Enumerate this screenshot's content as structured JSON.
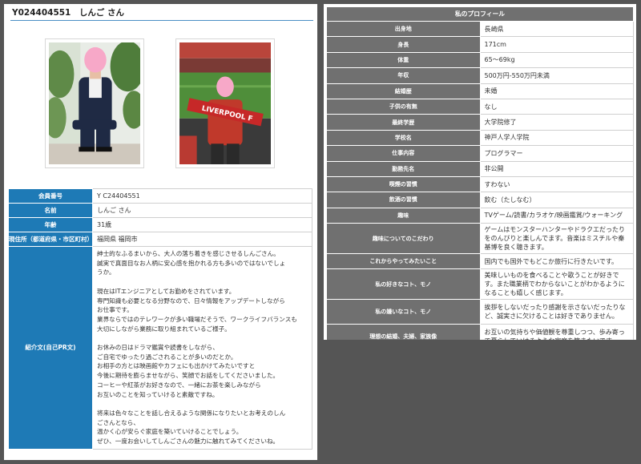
{
  "member": {
    "title": "Y024404551　しんご さん"
  },
  "photos": [
    {
      "icon": "profile-photo-suit"
    },
    {
      "icon": "profile-photo-stadium",
      "scarf_text": "LIVERPOOL F"
    }
  ],
  "basic_info": {
    "rows": [
      {
        "label": "会員番号",
        "value": "Y C24404551"
      },
      {
        "label": "名前",
        "value": "しんご さん"
      },
      {
        "label": "年齢",
        "value": "31歳"
      },
      {
        "label": "現住所（都道府県・市区町村）",
        "value": "福岡県 福岡市"
      }
    ],
    "intro_label": "紹介文(自己PR文)",
    "intro_lines": [
      "紳士的なふるまいから、大人の落ち着きを感じさせるしんごさん。",
      "誠実で真面目なお人柄に安心感を抱かれる方も多いのではないでしょ",
      "うか。",
      "",
      "現在はITエンジニアとしてお勤めをされています。",
      "専門知識も必要となる分野なので、日々情報をアップデートしながら",
      "お仕事です。",
      "業界ならではのテレワークが多い職場だそうで、ワークライフバランスも",
      "大切にしながら業務に取り組まれているご様子。",
      "",
      "お休みの日はドラマ鑑賞や読書をしながら、",
      "ご自宅でゆったり過ごされることが多いのだとか。",
      "お相手の方とは映画館やカフェにも出かけてみたいですと",
      "今後に期待を膨らませながら、笑顔でお話をしてくださいました。",
      "コーヒーや紅茶がお好きなので、一緒にお茶を楽しみながら",
      "お互いのことを知っていけると素敵ですね。",
      "",
      "将来は色々なことを話し合えるような関係になりたいとお考えのしん",
      "ごさんとなら、",
      "温かく心が安らぐ家庭を築いていけることでしょう。",
      "ぜひ、一度お会いしてしんごさんの魅力に触れてみてくださいね。"
    ]
  },
  "profile": {
    "title": "私のプロフィール",
    "rows": [
      {
        "label": "出身地",
        "value": "長崎県"
      },
      {
        "label": "身長",
        "value": "171cm"
      },
      {
        "label": "体重",
        "value": "65〜69kg"
      },
      {
        "label": "年収",
        "value": "500万円-550万円未満"
      },
      {
        "label": "結婚歴",
        "value": "未婚"
      },
      {
        "label": "子供の有無",
        "value": "なし"
      },
      {
        "label": "最終学歴",
        "value": "大学院修了"
      },
      {
        "label": "学校名",
        "value": "神戸人学人学院"
      },
      {
        "label": "仕事内容",
        "value": "プログラマー"
      },
      {
        "label": "勤務先名",
        "value": "非公開"
      },
      {
        "label": "喫煙の習慣",
        "value": "すわない"
      },
      {
        "label": "飲酒の習慣",
        "value": "飲む（たしなむ）"
      },
      {
        "label": "趣味",
        "value": "TVゲーム/読書/カラオケ/映画鑑賞/ウォーキング"
      },
      {
        "label": "趣味についてのこだわり",
        "value": "ゲームはモンスターハンターやドラクエだったりをのんびりと楽しんでます。音楽はミスチルや秦基博を良く聴きます。",
        "tall": true
      },
      {
        "label": "これからやってみたいこと",
        "value": "国内でも国外でもどこか旅行に行きたいです。"
      },
      {
        "label": "私の好きなコト、モノ",
        "value": "美味しいものを食べることや歌うことが好きです。また職業柄でわからないことがわかるようになることも嬉しく感じます。",
        "tall": true
      },
      {
        "label": "私の嫌いなコト、モノ",
        "value": "挨拶をしないだったり感謝を示さないだったりなど、誠実さに欠けることは好きでありません。",
        "tall": true
      },
      {
        "label": "理想の結婚、夫婦、家族像",
        "value": "お互いの気持ちや価値観を尊重しつつ、歩み寄って暮らしていけるような家庭を築きたいです。",
        "tall": true
      }
    ]
  }
}
